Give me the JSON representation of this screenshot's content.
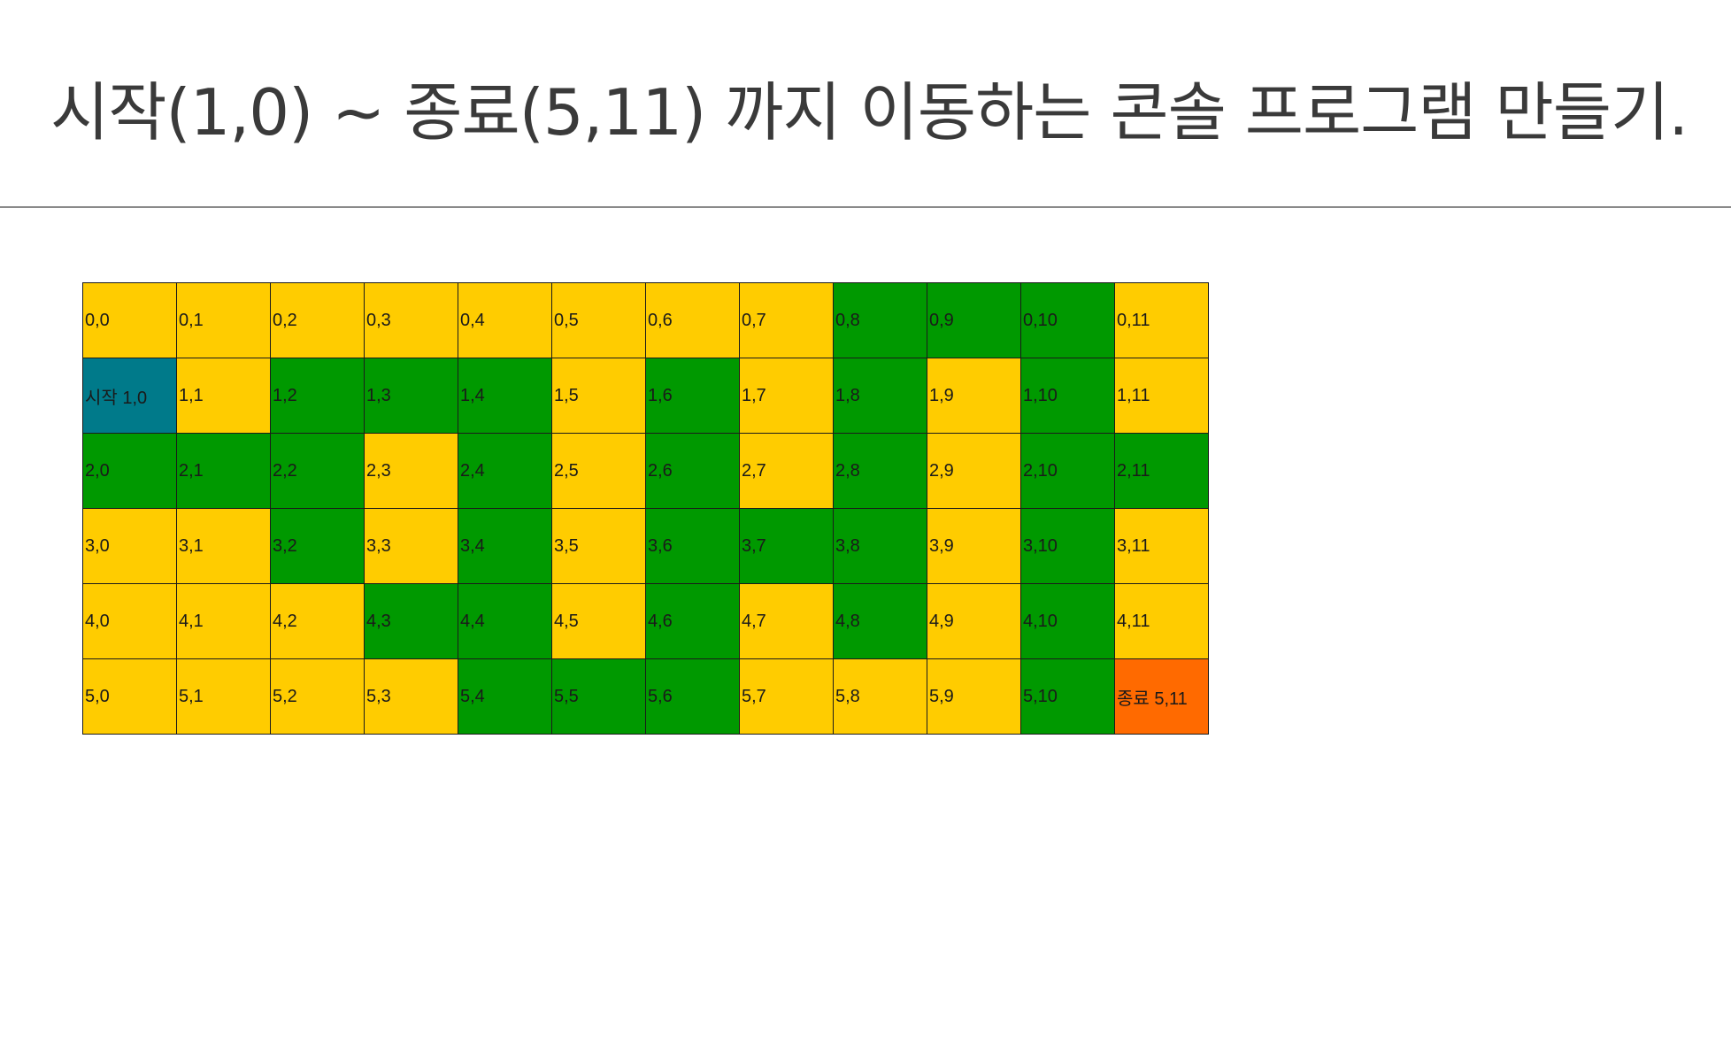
{
  "title": "시작(1,0) ~  종료(5,11) 까지 이동하는 콘솔 프로그램 만들기.",
  "colors": {
    "Y": "#ffcc00",
    "G": "#009900",
    "S": "#007a8a",
    "E": "#ff6a00"
  },
  "grid": {
    "rows": [
      {
        "cells": [
          {
            "label": "0,0",
            "color": "Y"
          },
          {
            "label": "0,1",
            "color": "Y"
          },
          {
            "label": "0,2",
            "color": "Y"
          },
          {
            "label": "0,3",
            "color": "Y"
          },
          {
            "label": "0,4",
            "color": "Y"
          },
          {
            "label": "0,5",
            "color": "Y"
          },
          {
            "label": "0,6",
            "color": "Y"
          },
          {
            "label": "0,7",
            "color": "Y"
          },
          {
            "label": "0,8",
            "color": "G"
          },
          {
            "label": "0,9",
            "color": "G"
          },
          {
            "label": "0,10",
            "color": "G"
          },
          {
            "label": "0,11",
            "color": "Y"
          }
        ]
      },
      {
        "cells": [
          {
            "label": "시작 1,0",
            "color": "S"
          },
          {
            "label": "1,1",
            "color": "Y"
          },
          {
            "label": "1,2",
            "color": "G"
          },
          {
            "label": "1,3",
            "color": "G"
          },
          {
            "label": "1,4",
            "color": "G"
          },
          {
            "label": "1,5",
            "color": "Y"
          },
          {
            "label": "1,6",
            "color": "G"
          },
          {
            "label": "1,7",
            "color": "Y"
          },
          {
            "label": "1,8",
            "color": "G"
          },
          {
            "label": "1,9",
            "color": "Y"
          },
          {
            "label": "1,10",
            "color": "G"
          },
          {
            "label": "1,11",
            "color": "Y"
          }
        ]
      },
      {
        "cells": [
          {
            "label": "2,0",
            "color": "G"
          },
          {
            "label": "2,1",
            "color": "G"
          },
          {
            "label": "2,2",
            "color": "G"
          },
          {
            "label": "2,3",
            "color": "Y"
          },
          {
            "label": "2,4",
            "color": "G"
          },
          {
            "label": "2,5",
            "color": "Y"
          },
          {
            "label": "2,6",
            "color": "G"
          },
          {
            "label": "2,7",
            "color": "Y"
          },
          {
            "label": "2,8",
            "color": "G"
          },
          {
            "label": "2,9",
            "color": "Y"
          },
          {
            "label": "2,10",
            "color": "G"
          },
          {
            "label": "2,11",
            "color": "G"
          }
        ]
      },
      {
        "cells": [
          {
            "label": "3,0",
            "color": "Y"
          },
          {
            "label": "3,1",
            "color": "Y"
          },
          {
            "label": "3,2",
            "color": "G"
          },
          {
            "label": "3,3",
            "color": "Y"
          },
          {
            "label": "3,4",
            "color": "G"
          },
          {
            "label": "3,5",
            "color": "Y"
          },
          {
            "label": "3,6",
            "color": "G"
          },
          {
            "label": "3,7",
            "color": "G"
          },
          {
            "label": "3,8",
            "color": "G"
          },
          {
            "label": "3,9",
            "color": "Y"
          },
          {
            "label": "3,10",
            "color": "G"
          },
          {
            "label": "3,11",
            "color": "Y"
          }
        ]
      },
      {
        "cells": [
          {
            "label": "4,0",
            "color": "Y"
          },
          {
            "label": "4,1",
            "color": "Y"
          },
          {
            "label": "4,2",
            "color": "Y"
          },
          {
            "label": "4,3",
            "color": "G"
          },
          {
            "label": "4,4",
            "color": "G"
          },
          {
            "label": "4,5",
            "color": "Y"
          },
          {
            "label": "4,6",
            "color": "G"
          },
          {
            "label": "4,7",
            "color": "Y"
          },
          {
            "label": "4,8",
            "color": "G"
          },
          {
            "label": "4,9",
            "color": "Y"
          },
          {
            "label": "4,10",
            "color": "G"
          },
          {
            "label": "4,11",
            "color": "Y"
          }
        ]
      },
      {
        "cells": [
          {
            "label": "5,0",
            "color": "Y"
          },
          {
            "label": "5,1",
            "color": "Y"
          },
          {
            "label": "5,2",
            "color": "Y"
          },
          {
            "label": "5,3",
            "color": "Y"
          },
          {
            "label": "5,4",
            "color": "G"
          },
          {
            "label": "5,5",
            "color": "G"
          },
          {
            "label": "5,6",
            "color": "G"
          },
          {
            "label": "5,7",
            "color": "Y"
          },
          {
            "label": "5,8",
            "color": "Y"
          },
          {
            "label": "5,9",
            "color": "Y"
          },
          {
            "label": "5,10",
            "color": "G"
          },
          {
            "label": "종료 5,11",
            "color": "E"
          }
        ]
      }
    ]
  }
}
